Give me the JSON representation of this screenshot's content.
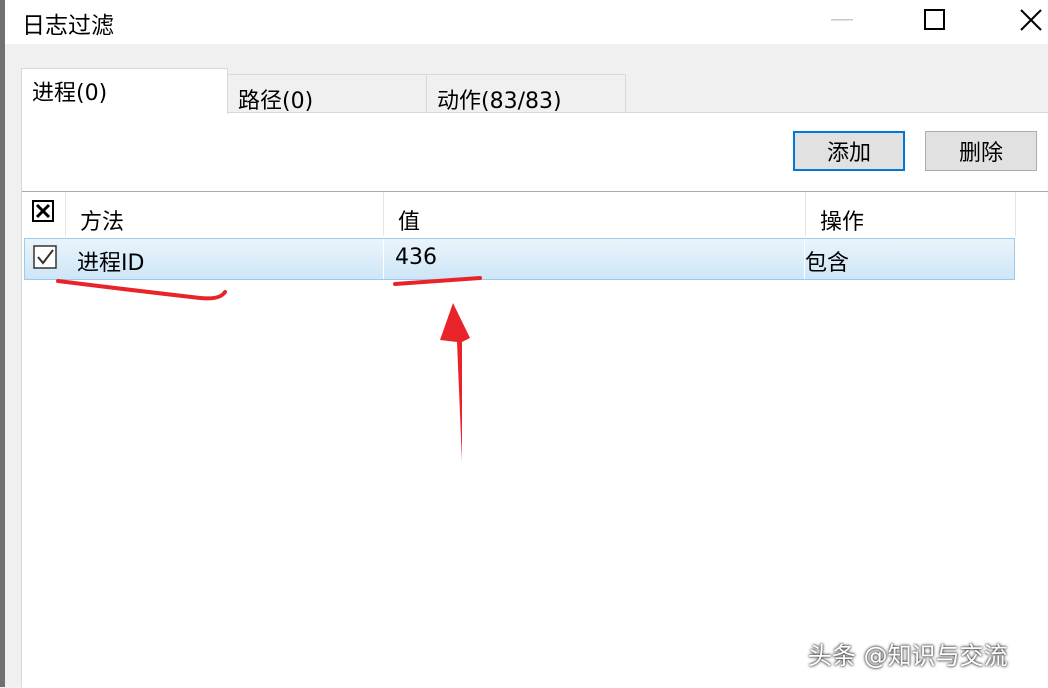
{
  "window": {
    "title": "日志过滤",
    "minimize_icon": "minimize-icon",
    "maximize_icon": "maximize-icon",
    "close_icon": "close-icon"
  },
  "tabs": [
    {
      "label": "进程(0)",
      "selected": true
    },
    {
      "label": "路径(0)",
      "selected": false
    },
    {
      "label": "动作(83/83)",
      "selected": false
    }
  ],
  "toolbar": {
    "add_label": "添加",
    "delete_label": "删除"
  },
  "list": {
    "header_check_icon": "checkbox-x-icon",
    "columns": [
      "方法",
      "值",
      "操作"
    ],
    "rows": [
      {
        "checked": true,
        "method": "进程ID",
        "value": "436",
        "operation": "包含"
      }
    ]
  },
  "annotation": {
    "color": "#e8242a"
  },
  "watermark": "头条 @知识与交流"
}
